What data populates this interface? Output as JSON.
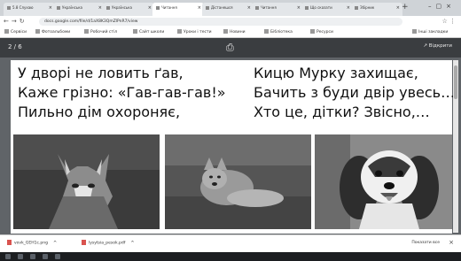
{
  "browser": {
    "tabs": [
      {
        "label": "5.8 Слухаю"
      },
      {
        "label": "Українська"
      },
      {
        "label": "Українська"
      },
      {
        "label": "Читання"
      },
      {
        "label": "Дістанешся"
      },
      {
        "label": "Читання"
      },
      {
        "label": "Що сказати"
      },
      {
        "label": "Збірник"
      }
    ],
    "url": "docs.google.com/file/d/1aX8K3QmZlPnR7/view",
    "bookmarks": [
      {
        "label": "Сервіси"
      },
      {
        "label": "Фотоальбоми"
      },
      {
        "label": "Робочий стіл"
      },
      {
        "label": "Сайт школи"
      },
      {
        "label": "Уроки і тести"
      },
      {
        "label": "Новини"
      },
      {
        "label": "Бібліотека"
      },
      {
        "label": "Ресурси"
      },
      {
        "label": "Інші закладки"
      }
    ]
  },
  "pdf_viewer": {
    "page_count": "2 / 6",
    "right_label": "Відкрити"
  },
  "poem": {
    "left": [
      "У дворі не ловить ґав,",
      "Каже грізно: «Гав-гав-гав!»",
      "Пильно дім охороняє,"
    ],
    "right": [
      "Кицю Мурку захищає,",
      "Бачить з буди двір увесь…",
      "Хто це, дітки? Звісно,…"
    ]
  },
  "photos": [
    {
      "icon": "wolf-photo"
    },
    {
      "icon": "fox-photo"
    },
    {
      "icon": "dog-photo"
    }
  ],
  "downloads": {
    "items": [
      {
        "label": "vovk_GEH1c.png"
      },
      {
        "label": "lysytsia_pesok.pdf"
      }
    ],
    "show_all": "Показати все"
  }
}
